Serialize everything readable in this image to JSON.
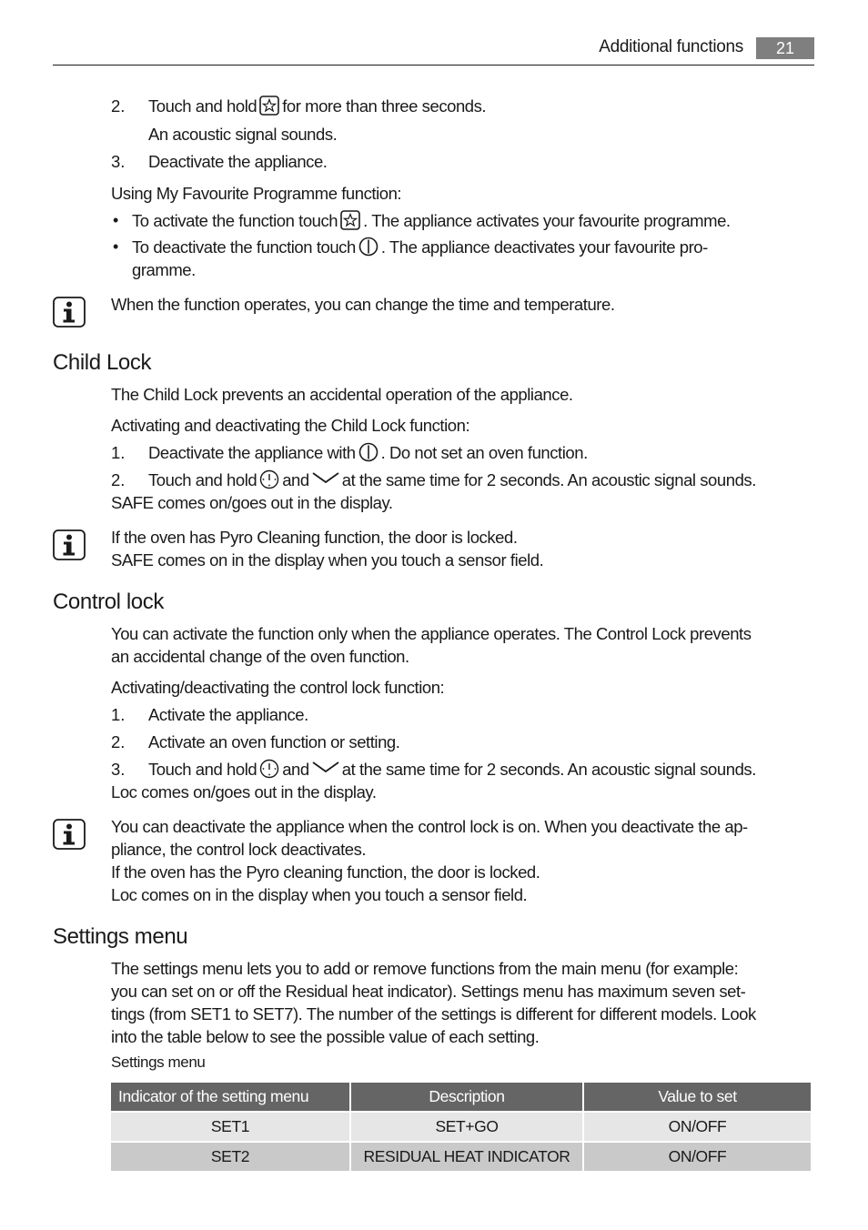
{
  "header": {
    "section_title": "Additional functions",
    "page_number": "21"
  },
  "favourite": {
    "steps": [
      {
        "num": "2.",
        "before_icon": "Touch and hold",
        "icon": "star-icon",
        "after_icon": "for more than three seconds."
      },
      {
        "num": "",
        "text": "An acoustic signal sounds."
      },
      {
        "num": "3.",
        "text": "Deactivate the appliance."
      }
    ],
    "using_heading": "Using My Favourite Programme function:",
    "bullets": [
      {
        "lead": "To activate the function",
        "before_icon": "touch",
        "icon": "star-icon",
        "after_icon": ". The appliance activates your favourite programme."
      },
      {
        "lead": "To deactivate the function",
        "before_icon": "touch",
        "icon": "power-icon",
        "after_icon": ". The appliance deactivates your favourite pro-",
        "continuation": "gramme."
      }
    ],
    "info_note": "When the function operates, you can change the time and temperature."
  },
  "child_lock": {
    "title": "Child Lock",
    "intro": "The Child Lock prevents an accidental operation of the appliance.",
    "subheading": "Activating and deactivating the Child Lock function:",
    "step1": {
      "num": "1.",
      "before_icon": "Deactivate the appliance with",
      "icon": "power-icon",
      "after_icon": ". Do not set an oven function."
    },
    "step2": {
      "num": "2.",
      "before_icon": "Touch and hold",
      "icon1": "clock-icon",
      "middle": "and",
      "icon2": "chevron-down-icon",
      "after_icon": "at the same time for 2 seconds. An acoustic signal sounds.",
      "continuation": "SAFE comes on/goes out in the display."
    },
    "info_lines": [
      "If the oven has Pyro Cleaning function, the door is locked.",
      "SAFE comes on in the display when you touch a sensor field."
    ]
  },
  "control_lock": {
    "title": "Control lock",
    "intro_lines": [
      "You can activate the function only when the appliance operates. The Control Lock prevents",
      "an accidental change of the oven function."
    ],
    "subheading": "Activating/deactivating the control lock function:",
    "steps": [
      {
        "num": "1.",
        "text": "Activate the appliance."
      },
      {
        "num": "2.",
        "text": "Activate an oven function or setting."
      }
    ],
    "step3": {
      "num": "3.",
      "before_icon": "Touch and hold",
      "icon1": "clock-icon",
      "middle": "and",
      "icon2": "chevron-down-icon",
      "after_icon": "at the same time for 2 seconds. An acoustic signal sounds.",
      "continuation": "Loc comes on/goes out in the display."
    },
    "info_lines": [
      "You can deactivate the appliance when the control lock is on. When you deactivate the ap-",
      "pliance, the control lock deactivates.",
      "If the oven has the Pyro cleaning function, the door is locked.",
      "Loc comes on in the display when you touch a sensor field."
    ]
  },
  "settings_menu": {
    "title": "Settings menu",
    "intro_lines": [
      "The settings menu lets you to add or remove functions from the main menu (for example:",
      "you can set on or off the Residual heat indicator). Settings menu has maximum seven set-",
      "tings (from SET1 to SET7). The number of the settings is different for different models. Look",
      "into the table below to see the possible value of each setting."
    ],
    "table_caption": "Settings menu",
    "table": {
      "headers": [
        "Indicator of the setting menu",
        "Description",
        "Value to set"
      ],
      "rows": [
        [
          "SET1",
          "SET+GO",
          "ON/OFF"
        ],
        [
          "SET2",
          "RESIDUAL HEAT INDICATOR",
          "ON/OFF"
        ]
      ]
    }
  },
  "colors": {
    "table_header_bg": "#656565",
    "table_row1_bg": "#e6e6e6",
    "table_row2_bg": "#c9c9c9",
    "page_number_bg": "#7f7f7f"
  }
}
